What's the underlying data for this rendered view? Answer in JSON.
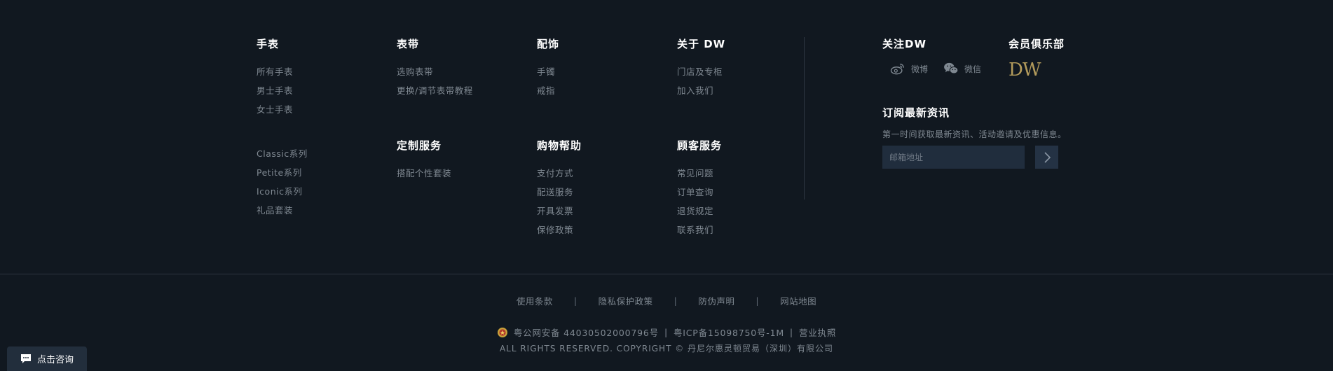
{
  "columns": {
    "watches": {
      "title": "手表",
      "links": [
        "所有手表",
        "男士手表",
        "女士手表"
      ],
      "links2": [
        "Classic系列",
        "Petite系列",
        "Iconic系列",
        "礼品套装"
      ]
    },
    "straps": {
      "title": "表带",
      "links": [
        "选购表带",
        "更换/调节表带教程"
      ]
    },
    "accessories": {
      "title": "配饰",
      "links": [
        "手镯",
        "戒指"
      ]
    },
    "about": {
      "title": "关于 DW",
      "links": [
        "门店及专柜",
        "加入我们"
      ]
    },
    "custom": {
      "title": "定制服务",
      "links": [
        "搭配个性套装"
      ]
    },
    "shopping": {
      "title": "购物帮助",
      "links": [
        "支付方式",
        "配送服务",
        "开具发票",
        "保修政策"
      ]
    },
    "service": {
      "title": "顾客服务",
      "links": [
        "常见问题",
        "订单查询",
        "退货规定",
        "联系我们"
      ]
    }
  },
  "follow": {
    "title": "关注DW",
    "weibo": "微博",
    "wechat": "微信"
  },
  "club": {
    "title": "会员俱乐部",
    "logo": "DW"
  },
  "subscribe": {
    "title": "订阅最新资讯",
    "desc": "第一时间获取最新资讯、活动邀请及优惠信息。",
    "placeholder": "邮箱地址"
  },
  "legal": {
    "links": [
      "使用条款",
      "隐私保护政策",
      "防伪声明",
      "网站地图"
    ],
    "sep": "|"
  },
  "record": {
    "police": "粤公网安备 44030502000796号",
    "icp": "粤ICP备15098750号-1M",
    "license": "营业执照",
    "sep": "|"
  },
  "copyright": "ALL RIGHTS RESERVED. COPYRIGHT © 丹尼尔惠灵顿贸易（深圳）有限公司",
  "consult": "点击咨询"
}
